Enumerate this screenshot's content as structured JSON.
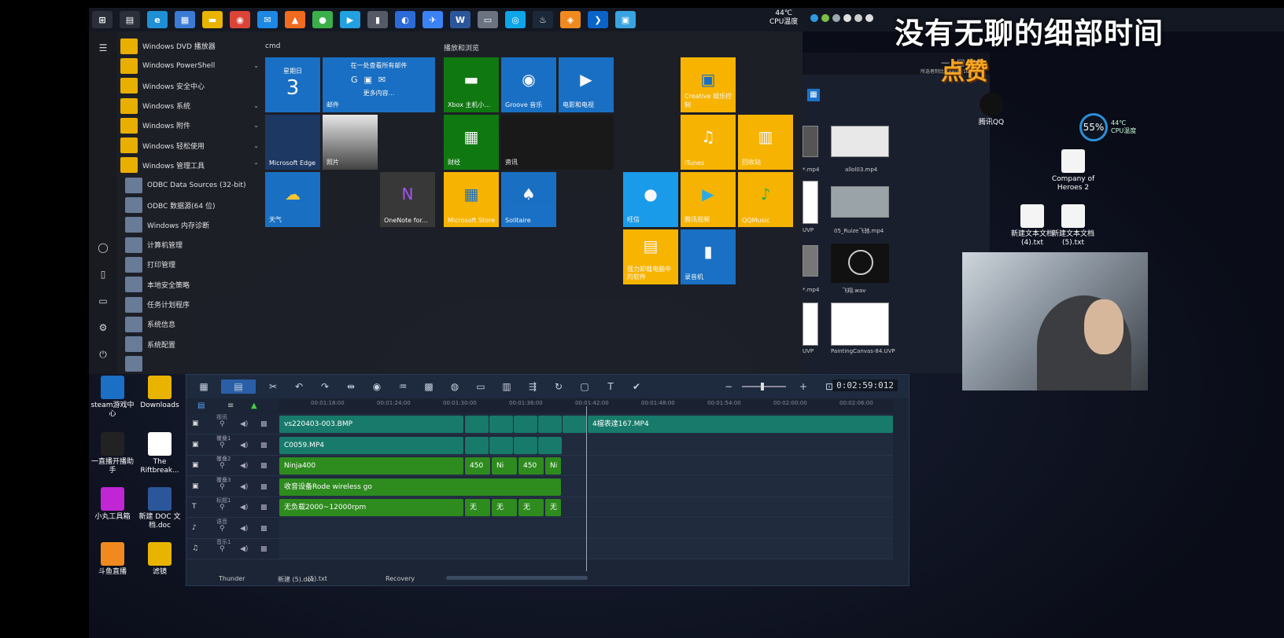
{
  "overlay": {
    "title": "没有无聊的细部时间",
    "like": "点赞"
  },
  "taskbar": {
    "icons": [
      {
        "name": "start-icon",
        "glyph": "⊞",
        "color": "#2b2f3a"
      },
      {
        "name": "taskview-icon",
        "glyph": "▤",
        "color": "#2b2f3a"
      },
      {
        "name": "edge-icon",
        "glyph": "e",
        "color": "#1f8fd6"
      },
      {
        "name": "store-icon",
        "glyph": "▦",
        "color": "#3a7bd5"
      },
      {
        "name": "explorer-icon",
        "glyph": "▬",
        "color": "#e8b400"
      },
      {
        "name": "chrome-icon",
        "glyph": "◉",
        "color": "#db4437"
      },
      {
        "name": "mail-icon",
        "glyph": "✉",
        "color": "#1e88e5"
      },
      {
        "name": "app-orange-icon",
        "glyph": "▲",
        "color": "#f06b1f"
      },
      {
        "name": "app-green-icon",
        "glyph": "●",
        "color": "#3bb04a"
      },
      {
        "name": "play-icon",
        "glyph": "▶",
        "color": "#22a0e0"
      },
      {
        "name": "mic-icon",
        "glyph": "▮",
        "color": "#555a66"
      },
      {
        "name": "app-round-icon",
        "glyph": "◐",
        "color": "#2c6ad8"
      },
      {
        "name": "bird-icon",
        "glyph": "✈",
        "color": "#3b82f6"
      },
      {
        "name": "word-icon",
        "glyph": "W",
        "color": "#2b579a"
      },
      {
        "name": "monitor-icon",
        "glyph": "▭",
        "color": "#6b7280"
      },
      {
        "name": "app-blue-icon",
        "glyph": "◎",
        "color": "#0ea5e9"
      },
      {
        "name": "steam-icon",
        "glyph": "♨",
        "color": "#1b2838"
      },
      {
        "name": "douyu-icon",
        "glyph": "◈",
        "color": "#f08a1f"
      },
      {
        "name": "terminal-icon",
        "glyph": "❯",
        "color": "#0a63c9"
      },
      {
        "name": "photo-icon",
        "glyph": "▣",
        "color": "#38a3e0"
      }
    ],
    "cpu_temp": "44℃",
    "cpu_label": "CPU温度"
  },
  "startmenu": {
    "app_list": [
      {
        "label": "Windows DVD 播放器",
        "kind": "app",
        "chev": ""
      },
      {
        "label": "Windows PowerShell",
        "kind": "folder",
        "chev": "⌄"
      },
      {
        "label": "Windows 安全中心",
        "kind": "app",
        "chev": ""
      },
      {
        "label": "Windows 系统",
        "kind": "folder",
        "chev": "⌄"
      },
      {
        "label": "Windows 附件",
        "kind": "folder",
        "chev": "⌄"
      },
      {
        "label": "Windows 轻松使用",
        "kind": "folder",
        "chev": "⌄"
      },
      {
        "label": "Windows 管理工具",
        "kind": "folder",
        "chev": "⌃"
      },
      {
        "label": "ODBC Data Sources (32-bit)",
        "kind": "sub",
        "chev": ""
      },
      {
        "label": "ODBC 数据源(64 位)",
        "kind": "sub",
        "chev": ""
      },
      {
        "label": "Windows 内存诊断",
        "kind": "sub",
        "chev": ""
      },
      {
        "label": "计算机管理",
        "kind": "sub",
        "chev": ""
      },
      {
        "label": "打印管理",
        "kind": "sub",
        "chev": ""
      },
      {
        "label": "本地安全策略",
        "kind": "sub",
        "chev": ""
      },
      {
        "label": "任务计划程序",
        "kind": "sub",
        "chev": ""
      },
      {
        "label": "系统信息",
        "kind": "sub",
        "chev": ""
      },
      {
        "label": "系统配置",
        "kind": "sub",
        "chev": ""
      },
      {
        "label": "",
        "kind": "sub",
        "chev": ""
      }
    ],
    "group1": "cmd",
    "group2": "播放和浏览",
    "calendar_day": "星期日",
    "calendar_num": "3",
    "mail_tile": {
      "top": "在一处查看所有邮件",
      "more": "更多内容...",
      "label": "邮件"
    },
    "tiles": {
      "edge": "Microsoft Edge",
      "photos": "照片",
      "weather": "天气",
      "onenote": "OneNote for...",
      "xbox": "Xbox 主机小...",
      "groove": "Groove 音乐",
      "movies": "电影和电视",
      "finance": "财经",
      "news": "资讯",
      "msstore": "Microsoft Store",
      "solitaire": "Solitaire",
      "creative": "Creative 娱乐控制",
      "itunes": "iTunes",
      "recycle": "回收站",
      "wangxin": "旺信",
      "tencentvideo": "腾讯视频",
      "qqmusic": "QQMusic",
      "uninstall": "强力卸载电脑中的软件",
      "recorder": "录音机"
    }
  },
  "filewin": {
    "resolution": "所选者制比 3840*2160",
    "items": [
      "*.mp4",
      "allol03.mp4",
      "UVP",
      "05_Ruize飞驰.mp4",
      "*.mp4",
      "飞翔.wav",
      "UVP",
      "PaintingCanvas-84.UVP"
    ]
  },
  "desktop_icons": [
    {
      "label": "steam游戏中心",
      "color": "#1b6fc4"
    },
    {
      "label": "Downloads",
      "color": "#e8b400"
    },
    {
      "label": "一直播开播助手",
      "color": "#222"
    },
    {
      "label": "The Riftbreak...",
      "color": "#ffffff"
    },
    {
      "label": "小丸工具箱",
      "color": "#c026d3"
    },
    {
      "label": "新建 DOC 文档.doc",
      "color": "#2b579a"
    },
    {
      "label": "斗鱼直播",
      "color": "#f08a1f"
    },
    {
      "label": "滤镜",
      "color": "#e8b400"
    }
  ],
  "right_icons": [
    {
      "label": "腾讯QQ"
    },
    {
      "label": "Company of Heroes 2"
    },
    {
      "label": "新建文本文档 (4).txt"
    },
    {
      "label": "新建文本文档 (5).txt"
    }
  ],
  "cpu_gauge": {
    "value": "55%",
    "temp": "44℃",
    "label": "CPU温度"
  },
  "editor": {
    "timecode": "0:02:59:012",
    "ruler": [
      "00:01:18:00",
      "00:01:24:00",
      "00:01:30:00",
      "00:01:36:00",
      "00:01:42:00",
      "00:01:48:00",
      "00:01:54:00",
      "00:02:00:00",
      "00:02:06:00"
    ],
    "tracks": [
      {
        "id": "1",
        "label": "视讯",
        "icon": "▣"
      },
      {
        "id": "1",
        "label": "覆叠1",
        "icon": "▣"
      },
      {
        "id": "2",
        "label": "覆叠2",
        "icon": "▣"
      },
      {
        "id": "3",
        "label": "覆叠3",
        "icon": "▣"
      },
      {
        "id": "T",
        "label": "标题1",
        "icon": "T"
      },
      {
        "id": "",
        "label": "语音",
        "icon": "♪"
      },
      {
        "id": "",
        "label": "音乐1",
        "icon": "♫"
      }
    ],
    "clips": {
      "video_main": "vs220403-003.BMP",
      "video_right": "4檔表達167.MP4",
      "overlay1": "C0059.MP4",
      "ov2_main": "Ninja400",
      "ov2_a": "450",
      "ov2_b": "Ni",
      "ov2_c": "450",
      "ov2_d": "Ni",
      "ov3": "收音设备Rode wireless go",
      "title_main": "无负载2000~12000rpm",
      "title_a": "无",
      "title_b": "无",
      "title_c": "无",
      "title_d": "无"
    },
    "footer_under": [
      "Thunder",
      "新建 (5).doc",
      "(5).txt",
      "Recovery"
    ]
  }
}
